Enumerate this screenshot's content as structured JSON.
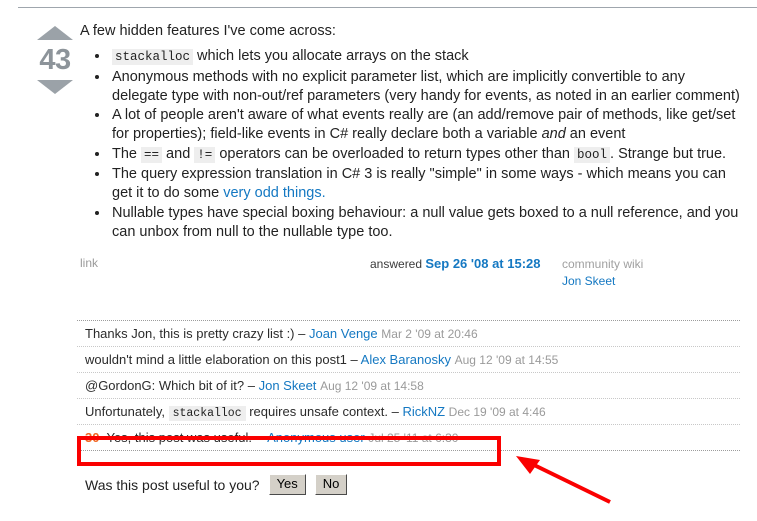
{
  "post": {
    "vote_count": "43",
    "vote_up_icon": "triangle-up-icon",
    "vote_down_icon": "triangle-down-icon",
    "intro": "A few hidden features I've come across:",
    "bullets": [
      {
        "parts": [
          {
            "type": "code",
            "text": "stackalloc"
          },
          {
            "type": "text",
            "text": " which lets you allocate arrays on the stack"
          }
        ]
      },
      {
        "parts": [
          {
            "type": "text",
            "text": "Anonymous methods with no explicit parameter list, which are implicitly convertible to any delegate type with non-out/ref parameters (very handy for events, as noted in an earlier comment)"
          }
        ]
      },
      {
        "parts": [
          {
            "type": "text",
            "text": "A lot of people aren't aware of what events really are (an add/remove pair of methods, like get/set for properties); field-like events in C# really declare both a variable "
          },
          {
            "type": "em",
            "text": "and"
          },
          {
            "type": "text",
            "text": " an event"
          }
        ]
      },
      {
        "parts": [
          {
            "type": "text",
            "text": "The "
          },
          {
            "type": "code",
            "text": "=="
          },
          {
            "type": "text",
            "text": " and "
          },
          {
            "type": "code",
            "text": "!="
          },
          {
            "type": "text",
            "text": " operators can be overloaded to return types other than "
          },
          {
            "type": "code",
            "text": "bool"
          },
          {
            "type": "text",
            "text": ". Strange but true."
          }
        ]
      },
      {
        "parts": [
          {
            "type": "text",
            "text": "The query expression translation in C# 3 is really \"simple\" in some ways - which means you can get it to do some "
          },
          {
            "type": "link",
            "text": "very odd things."
          }
        ]
      },
      {
        "parts": [
          {
            "type": "text",
            "text": "Nullable types have special boxing behaviour: a null value gets boxed to a null reference, and you can unbox from null to the nullable type too."
          }
        ]
      }
    ],
    "footer": {
      "link_label": "link",
      "answered_label": "answered",
      "answered_date": "Sep 26 '08 at 15:28",
      "wiki_label": "community wiki",
      "wiki_user": "Jon Skeet"
    }
  },
  "comments": [
    {
      "score": "",
      "text": "Thanks Jon, this is pretty crazy list :)",
      "dash": "–",
      "user": "Joan Venge",
      "date": "Mar 2 '09 at 20:46",
      "highlighted": false
    },
    {
      "score": "",
      "text": "wouldn't mind a little elaboration on this post1",
      "dash": "–",
      "user": "Alex Baranosky",
      "date": "Aug 12 '09 at 14:55",
      "highlighted": false
    },
    {
      "score": "",
      "text": "@GordonG: Which bit of it?",
      "dash": "–",
      "user": "Jon Skeet",
      "date": "Aug 12 '09 at 14:58",
      "highlighted": false
    },
    {
      "score": "",
      "text_before": "Unfortunately,",
      "code": "stackalloc",
      "text_after": "requires unsafe context.",
      "dash": "–",
      "user": "RickNZ",
      "date": "Dec 19 '09 at 4:46",
      "highlighted": false
    },
    {
      "score": "30",
      "text": "Yes, this post was useful. --",
      "dash": "",
      "user": "Anonymous user",
      "date": "Jul 25 '11 at 6:30",
      "highlighted": true
    }
  ],
  "poll": {
    "question": "Was this post useful to you?",
    "yes_label": "Yes",
    "no_label": "No"
  },
  "annotations": {
    "highlight_box_color": "#fa0000",
    "arrow_color": "#fa0000",
    "arrow_name": "red-pointer-arrow"
  },
  "colors": {
    "link_blue": "#1478c2",
    "score_orange": "#f26522",
    "vote_gray": "#9ba2a8",
    "muted_gray": "#9a9a9a",
    "code_bg": "#eeeeee"
  }
}
